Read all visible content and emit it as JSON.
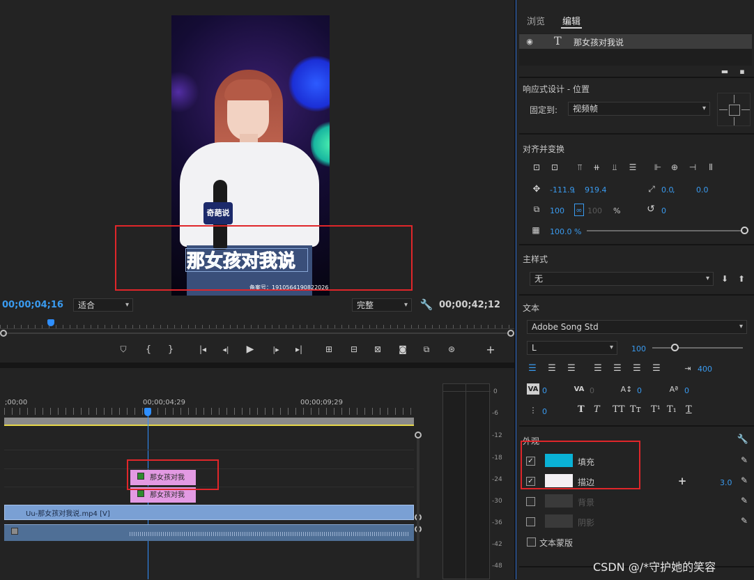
{
  "preview": {
    "caption": "那女孩对我说",
    "record_no": "备案号：1910564190822026",
    "mic_logo": "奇葩说"
  },
  "monitor": {
    "current_time": "00;00;04;16",
    "zoom": "适合",
    "quality": "完整",
    "duration": "00;00;42;12"
  },
  "timeline": {
    "times": [
      ";00;00",
      "00;00;04;29",
      "00;00;09;29"
    ],
    "clip_text_1": "那女孩对我",
    "clip_text_2": "那女孩对我",
    "video_clip": "Uu-那女孩对我说.mp4 [V]"
  },
  "meter_labels": [
    "0",
    "-6",
    "-12",
    "-18",
    "-24",
    "-30",
    "-36",
    "-42",
    "-48"
  ],
  "panel": {
    "tabs": [
      "浏览",
      "编辑"
    ],
    "layer_name": "那女孩对我说",
    "responsive_title": "响应式设计 - 位置",
    "pin_label": "固定到:",
    "pin_value": "视频帧",
    "align_title": "对齐并变换",
    "pos_x": "-111.9",
    "pos_sep": ",",
    "pos_y": "919.4",
    "anchor_x": "0.0",
    "anchor_sep": ",",
    "anchor_y": "0.0",
    "scale": "100",
    "scale_dim": "100",
    "percent": "%",
    "rotation": "0",
    "opacity": "100.0 %",
    "master_style_title": "主样式",
    "master_style_value": "无",
    "text_title": "文本",
    "font": "Adobe Song Std",
    "font_style": "L",
    "font_size": "100",
    "tab_width": "400",
    "kerning": "0",
    "tracking": "0",
    "leading": "0",
    "baseline": "0",
    "tsume": "0",
    "appearance_title": "外观",
    "fill_label": "填充",
    "stroke_label": "描边",
    "stroke_width": "3.0",
    "bg_label": "背景",
    "shadow_label": "阴影",
    "mask_label": "文本蒙版"
  },
  "colors": {
    "fill": "#0ab2d6",
    "stroke": "#f4f0f4",
    "accent": "#3a9bf0",
    "highlight": "#e0262a"
  },
  "watermark": "CSDN @/*守护她的笑容"
}
